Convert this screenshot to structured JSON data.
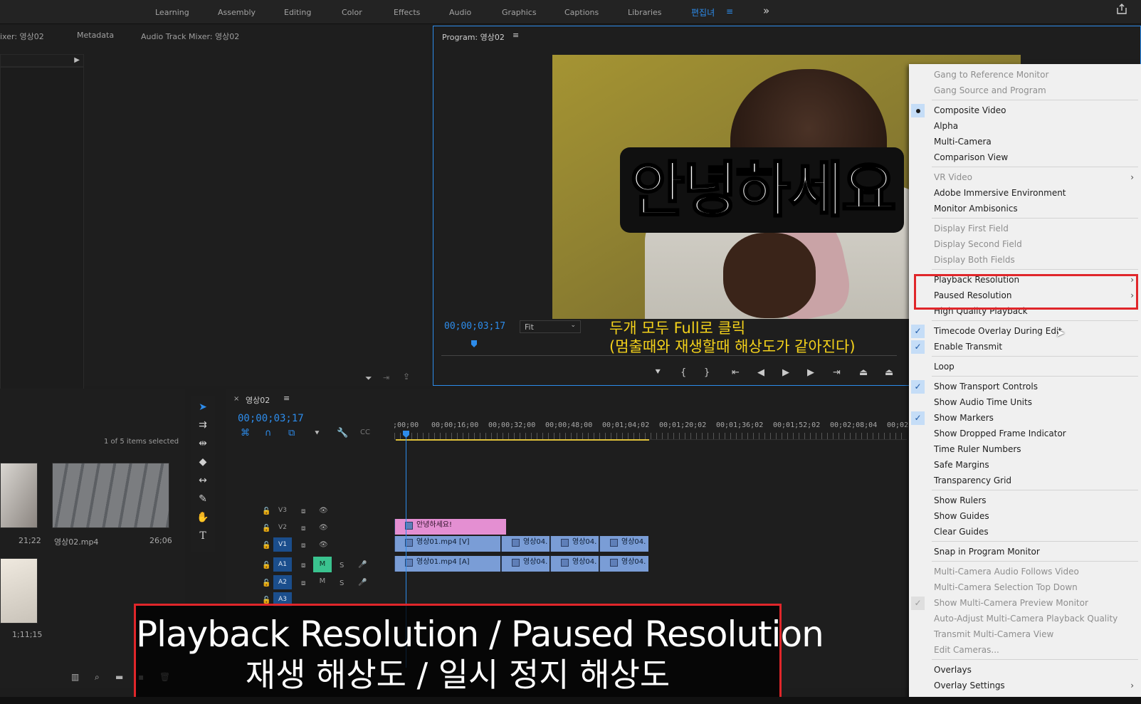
{
  "workspace": {
    "tabs": [
      "Learning",
      "Assembly",
      "Editing",
      "Color",
      "Effects",
      "Audio",
      "Graphics",
      "Captions",
      "Libraries"
    ],
    "active_tab": "편집녀",
    "active_tab_menu": "≡",
    "more": "»"
  },
  "source_panel": {
    "tab_mixer": "ixer: 영상02",
    "tab_metadata": "Metadata",
    "tab_audio_mixer": "Audio Track Mixer: 영상02"
  },
  "program_monitor": {
    "title": "Program: 영상02",
    "menu": "≡",
    "timecode": "00;00;03;17",
    "fit": "Fit",
    "video_caption": "안녕하세요",
    "note_line1": "두개 모두 Full로 클릭",
    "note_line2": "(멈출때와 재생할때 해상도가 같아진다)"
  },
  "project": {
    "selection_status": "1 of 5 items selected",
    "items": [
      {
        "name": "",
        "duration": "21;22"
      },
      {
        "name": "영상02.mp4",
        "duration": "26;06"
      },
      {
        "name": "",
        "duration": "1;11;15"
      }
    ]
  },
  "timeline": {
    "close": "×",
    "title": "영상02",
    "menu": "≡",
    "timecode": "00;00;03;17",
    "ruler": [
      ";00;00",
      "00;00;16;00",
      "00;00;32;00",
      "00;00;48;00",
      "00;01;04;02",
      "00;01;20;02",
      "00;01;36;02",
      "00;01;52;02",
      "00;02;08;04",
      "00;02;"
    ],
    "tracks": [
      "V3",
      "V2",
      "V1",
      "A1",
      "A2",
      "A3"
    ],
    "mute": "M",
    "solo": "S",
    "clips": {
      "title": "안녕하세요!",
      "v1_main": "영상01.mp4 [V]",
      "a1_main": "영상01.mp4 [A]",
      "short": "영상04."
    }
  },
  "context_menu": {
    "items": [
      {
        "label": "Gang to Reference Monitor",
        "state": "disabled"
      },
      {
        "label": "Gang Source and Program",
        "state": "disabled"
      },
      {
        "label": "Composite Video",
        "state": "radio"
      },
      {
        "label": "Alpha",
        "state": "normal"
      },
      {
        "label": "Multi-Camera",
        "state": "normal"
      },
      {
        "label": "Comparison View",
        "state": "normal"
      },
      {
        "label": "VR Video",
        "state": "disabled-sub"
      },
      {
        "label": "Adobe Immersive Environment",
        "state": "normal"
      },
      {
        "label": "Monitor Ambisonics",
        "state": "normal"
      },
      {
        "label": "Display First Field",
        "state": "disabled"
      },
      {
        "label": "Display Second Field",
        "state": "disabled"
      },
      {
        "label": "Display Both Fields",
        "state": "disabled"
      },
      {
        "label": "Playback Resolution",
        "state": "sub"
      },
      {
        "label": "Paused Resolution",
        "state": "sub"
      },
      {
        "label": "High Quality Playback",
        "state": "normal"
      },
      {
        "label": "Timecode Overlay During Edit",
        "state": "checked"
      },
      {
        "label": "Enable Transmit",
        "state": "checked"
      },
      {
        "label": "Loop",
        "state": "normal"
      },
      {
        "label": "Show Transport Controls",
        "state": "checked"
      },
      {
        "label": "Show Audio Time Units",
        "state": "normal"
      },
      {
        "label": "Show Markers",
        "state": "checked"
      },
      {
        "label": "Show Dropped Frame Indicator",
        "state": "normal"
      },
      {
        "label": "Time Ruler Numbers",
        "state": "normal"
      },
      {
        "label": "Safe Margins",
        "state": "normal"
      },
      {
        "label": "Transparency Grid",
        "state": "normal"
      },
      {
        "label": "Show Rulers",
        "state": "normal"
      },
      {
        "label": "Show Guides",
        "state": "normal"
      },
      {
        "label": "Clear Guides",
        "state": "normal"
      },
      {
        "label": "Snap in Program Monitor",
        "state": "normal"
      },
      {
        "label": "Multi-Camera Audio Follows Video",
        "state": "disabled"
      },
      {
        "label": "Multi-Camera Selection Top Down",
        "state": "disabled"
      },
      {
        "label": "Show Multi-Camera Preview Monitor",
        "state": "disabled-checked"
      },
      {
        "label": "Auto-Adjust Multi-Camera Playback Quality",
        "state": "disabled"
      },
      {
        "label": "Transmit Multi-Camera View",
        "state": "disabled"
      },
      {
        "label": "Edit Cameras...",
        "state": "disabled"
      },
      {
        "label": "Overlays",
        "state": "normal"
      },
      {
        "label": "Overlay Settings",
        "state": "sub"
      }
    ]
  },
  "caption": {
    "english": "Playback Resolution / Paused Resolution",
    "korean": "재생 해상도 / 일시 정지 해상도"
  },
  "colors": {
    "accent": "#2d8ceb",
    "highlight_border": "#e0262a",
    "note_text": "#f4d21b",
    "menu_bg": "#f0f0f0"
  }
}
